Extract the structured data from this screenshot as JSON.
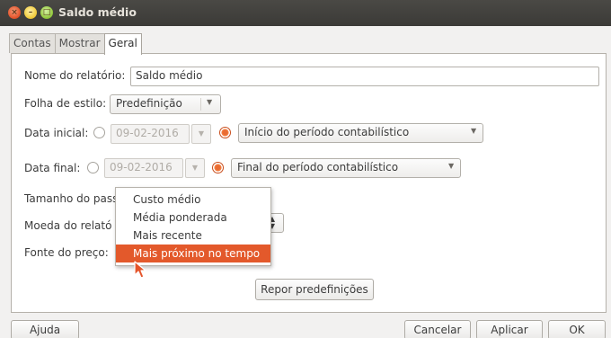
{
  "window": {
    "title": "Saldo médio"
  },
  "tabs": [
    "Contas",
    "Mostrar",
    "Geral"
  ],
  "form": {
    "report_name_label": "Nome do relatório:",
    "report_name_value": "Saldo médio",
    "style_sheet_label": "Folha de estilo:",
    "style_sheet_value": "Predefinição",
    "start_date_label": "Data inicial:",
    "start_date_value": "09-02-2016",
    "start_period_value": "Início do período contabilístico",
    "end_date_label": "Data final:",
    "end_date_value": "09-02-2016",
    "end_period_value": "Final do período contabilístico",
    "step_size_label": "Tamanho do pass",
    "currency_label": "Moeda do relató",
    "price_source_label": "Fonte do preço:"
  },
  "dropdown": {
    "items": [
      "Custo médio",
      "Média ponderada",
      "Mais recente",
      "Mais próximo no tempo"
    ],
    "selected_index": 3
  },
  "buttons": {
    "reset": "Repor predefinições",
    "help": "Ajuda",
    "cancel": "Cancelar",
    "apply": "Aplicar",
    "ok": "OK"
  },
  "colors": {
    "accent": "#e3592b",
    "titlebar": "#3c3b37"
  }
}
